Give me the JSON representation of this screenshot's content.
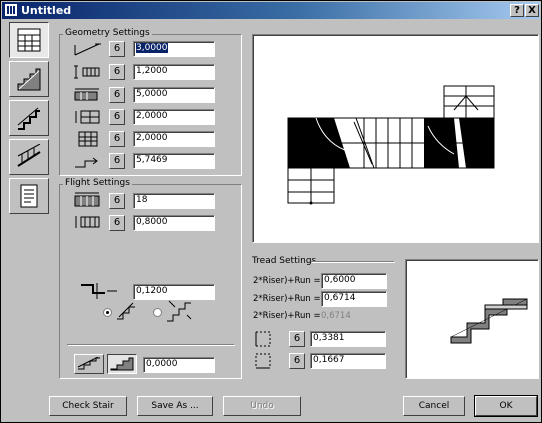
{
  "window": {
    "title": "Untitled",
    "help_label": "?",
    "close_label": "X"
  },
  "toolbar": {
    "tools": [
      {
        "name": "geometry-tool-icon",
        "active": true
      },
      {
        "name": "stair-profile-tool-icon",
        "active": false
      },
      {
        "name": "stair-side-tool-icon",
        "active": false
      },
      {
        "name": "railing-tool-icon",
        "active": false
      },
      {
        "name": "document-tool-icon",
        "active": false
      }
    ]
  },
  "geometry": {
    "label": "Geometry Settings",
    "rows": [
      {
        "icon": "slope-dimension-icon",
        "value_selected": "3,0000",
        "value_rest": ""
      },
      {
        "icon": "width-dimension-icon",
        "value_selected": "",
        "value_rest": "1,2000"
      },
      {
        "icon": "landing-dimension-icon",
        "value_selected": "",
        "value_rest": "5,0000"
      },
      {
        "icon": "stair-offset-icon",
        "value_selected": "",
        "value_rest": "2,0000"
      },
      {
        "icon": "grid-dimension-icon",
        "value_selected": "",
        "value_rest": "2,0000"
      },
      {
        "icon": "walking-line-icon",
        "value_selected": "",
        "value_rest": "5,7469"
      }
    ],
    "lock_label": "6"
  },
  "flight": {
    "label": "Flight Settings",
    "rows": [
      {
        "icon": "riser-count-icon",
        "value": "18"
      },
      {
        "icon": "tread-width-icon",
        "value": "0,8000"
      }
    ],
    "thickness_value": "0,1200",
    "bottom_value": "0,0000"
  },
  "tread": {
    "label": "Tread Settings",
    "formula_1": "2*Riser)+Run =",
    "value_1": "0,6000",
    "formula_2": "2*Riser)+Run =",
    "value_2": "0,6714",
    "formula_3": "2*Riser)+Run =",
    "value_3": "0,6714",
    "riser_value": "0,3381",
    "run_value": "0,1667"
  },
  "buttons": {
    "check_stair": "Check Stair",
    "save_as": "Save As ...",
    "undo": "Undo",
    "cancel": "Cancel",
    "ok": "OK"
  },
  "colors": {
    "titlebar_start": "#08246b",
    "titlebar_end": "#a6caf0",
    "selection": "#0a246a"
  }
}
